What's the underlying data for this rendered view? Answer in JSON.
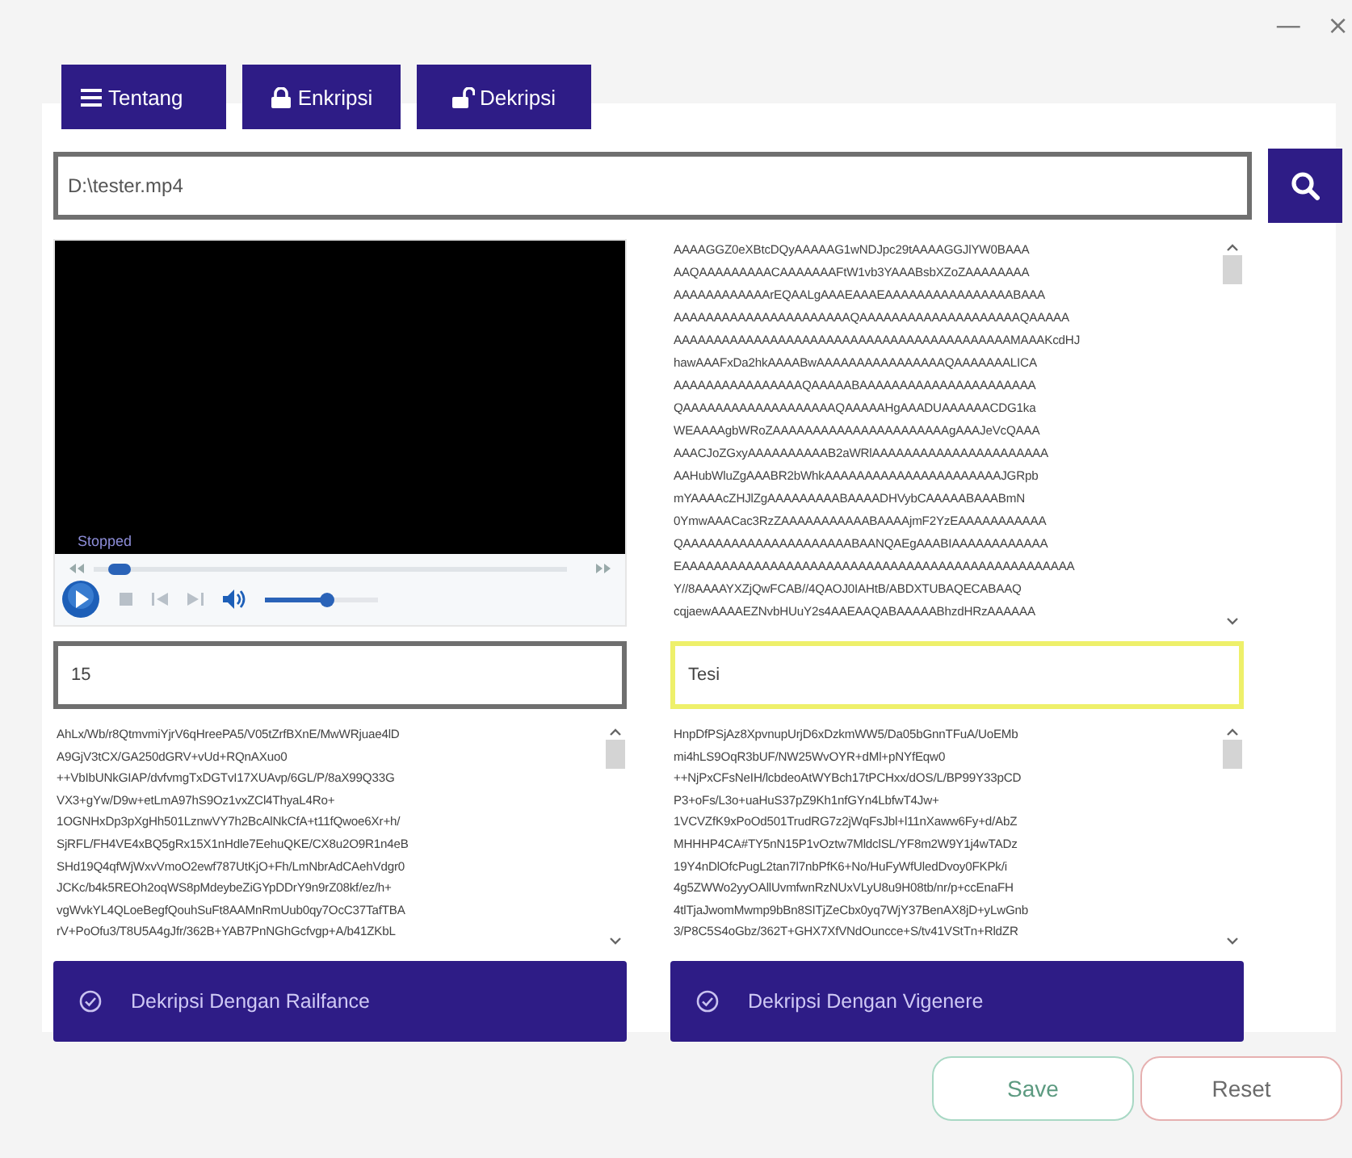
{
  "window": {
    "minimize": "—",
    "close": "×"
  },
  "tabs": [
    {
      "label": "Tentang",
      "kind": "menu"
    },
    {
      "label": "Enkripsi",
      "kind": "lock"
    },
    {
      "label": "Dekripsi",
      "kind": "unlock"
    }
  ],
  "file_path": {
    "value": "D:\\tester.mp4"
  },
  "video_player": {
    "status": "Stopped",
    "seek": {
      "level": 0.03
    },
    "volume": {
      "level": 0.55
    }
  },
  "source_text": [
    "AAAAGGZ0eXBtcDQyAAAAAG1wNDJpc29tAAAAGGJlYW0BAAA",
    "AAQAAAAAAAAACAAAAAAAFtW1vb3YAAABsbXZoZAAAAAAAA",
    "AAAAAAAAAAAArEQAALgAAAEAAAEAAAAAAAAAAAAAAAABAAA",
    "AAAAAAAAAAAAAAAAAAAAAAQAAAAAAAAAAAAAAAAAAAAQAAAAA",
    "AAAAAAAAAAAAAAAAAAAAAAAAAAAAAAAAAAAAAAAAAAMAAAKcdHJ",
    "hawAAAFxDa2hkAAAABwAAAAAAAAAAAAAAAAQAAAAAAALICA",
    "AAAAAAAAAAAAAAAAQAAAAABAAAAAAAAAAAAAAAAAAAAAA",
    "QAAAAAAAAAAAAAAAAAAAQAAAAAHgAAADUAAAAAACDG1ka",
    "WEAAAAgbWRoZAAAAAAAAAAAAAAAAAAAAAAgAAAJeVcQAAA",
    "AAACJoZGxyAAAAAAAAAAB2aWRlAAAAAAAAAAAAAAAAAAAAAA",
    "AAHubWluZgAAABR2bWhkAAAAAAAAAAAAAAAAAAAAAAJGRpb",
    "mYAAAAcZHJlZgAAAAAAAAABAAAADHVybCAAAAABAAABmN",
    "0YmwAAACac3RzZAAAAAAAAAAABAAAAjmF2YzEAAAAAAAAAAA",
    "QAAAAAAAAAAAAAAAAAAAAABAANQAEgAAABIAAAAAAAAAAAA",
    "EAAAAAAAAAAAAAAAAAAAAAAAAAAAAAAAAAAAAAAAAAAAAAAAAA",
    "Y//8AAAAYXZjQwFCAB//4QAOJ0IAHtB/ABDXTUBAQECABAAQ",
    "cqjaewAAAAEZNvbHUuY2s4AAEAAQABAAAAABhzdHRzAAAAAA"
  ],
  "panels": [
    {
      "key_field": {
        "value": "15",
        "focused": false
      },
      "text": [
        "AhLx/Wb/r8QtmvmiYjrV6qHreePA5/V05tZrfBXnE/MwWRjuae4lD",
        "A9GjV3tCX/GA250dGRV+vUd+RQnAXuo0",
        "++VbIbUNkGIAP/dvfvmgTxDGTvI17XUAvp/6GL/P/8aX99Q33G",
        "VX3+gYw/D9w+etLmA97hS9Oz1vxZCl4ThyaL4Ro+",
        "1OGNHxDp3pXgHh501LznwVY7h2BcAlNkCfA+t11fQwoe6Xr+h/",
        "SjRFL/FH4VE4xBQ5gRx15X1nHdle7EehuQKE/CX8u2O9R1n4eB",
        "SHd19Q4qfWjWxvVmoO2ewf787UtKjO+Fh/LmNbrAdCAehVdgr0",
        "JCKc/b4k5REOh2oqWS8pMdeybeZiGYpDDrY9n9rZ08kf/ez/h+",
        "vgWvkYL4QLoeBegfQouhSuFt8AAMnRmUub0qy7OcC37TafTBA",
        "rV+PoOfu3/T8U5A4gJfr/362B+YAB7PnNGhGcfvgp+A/b41ZKbL"
      ],
      "button": "Dekripsi Dengan Railfance"
    },
    {
      "key_field": {
        "value": "Tesi",
        "focused": true
      },
      "text": [
        "HnpDfPSjAz8XpvnupUrjD6xDzkmWW5/Da05bGnnTFuA/UoEMb",
        "mi4hLS9OqR3bUF/NW25WvOYR+dMl+pNYfEqw0",
        "++NjPxCFsNeIH/lcbdeoAtWYBch17tPCHxx/dOS/L/BP99Y33pCD",
        "P3+oFs/L3o+uaHuS37pZ9Kh1nfGYn4LbfwT4Jw+",
        "1VCVZfK9xPoOd501TrudRG7z2jWqFsJbl+l11nXaww6Fy+d/AbZ",
        "MHHHP4CA#TY5nN15P1vOztw7MldclSL/YF8m2W9Y1j4wTADz",
        "19Y4nDlOfcPugL2tan7l7nbPfK6+No/HuFyWfUledDvoy0FKPk/i",
        "4g5ZWWo2yyOAllUvmfwnRzNUxVLyU8u9H08tb/nr/p+ccEnaFH",
        "4tlTjaJwomMwmp9bBn8SITjZeCbx0yq7WjY37BenAX8jD+yLwGnb",
        "3/P8C5S4oGbz/362T+GHX7XfVNdOuncce+S/tv41VStTn+RldZR"
      ],
      "button": "Dekripsi Dengan Vigenere"
    }
  ],
  "footer_buttons": [
    {
      "label": "Save",
      "kind": "save"
    },
    {
      "label": "Reset",
      "kind": "reset"
    }
  ]
}
